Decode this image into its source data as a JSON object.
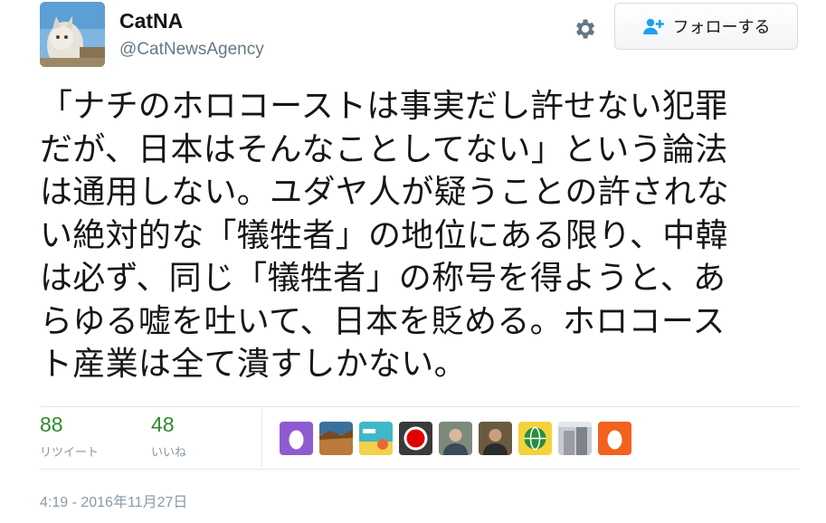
{
  "user": {
    "display_name": "CatNA",
    "screen_name": "@CatNewsAgency"
  },
  "follow_button": {
    "label": "フォローする",
    "icon": "person-add-icon"
  },
  "settings_icon": "gear-icon",
  "tweet": {
    "lines": [
      "「ナチのホロコーストは事実だし許せない犯罪",
      "だが、日本はそんなことしてない」という論法",
      "は通用しない。ユダヤ人が疑うことの許されな",
      "い絶対的な「犠牲者」の地位にある限り、中韓",
      "は必ず、同じ「犠牲者」の称号を得ようと、あ",
      "らゆる嘘を吐いて、日本を貶める。ホロコース",
      "ト産業は全て潰すしかない。"
    ]
  },
  "stats": {
    "retweets": {
      "count": "88",
      "label": "リツイート"
    },
    "likes": {
      "count": "48",
      "label": "いいね"
    }
  },
  "likers": [
    {
      "kind": "egg",
      "color": "#8e5bd1"
    },
    {
      "kind": "landscape",
      "color": "#b97a3c"
    },
    {
      "kind": "cartoon",
      "color": "#3fb8c8"
    },
    {
      "kind": "flag",
      "color": "#e00000"
    },
    {
      "kind": "photo",
      "color": "#7d8a7a"
    },
    {
      "kind": "photo",
      "color": "#6a5a3f"
    },
    {
      "kind": "globe",
      "color": "#2a8c3c"
    },
    {
      "kind": "building",
      "color": "#9a9ea4"
    },
    {
      "kind": "egg",
      "color": "#f2611d"
    }
  ],
  "timestamp": "4:19 - 2016年11月27日",
  "colors": {
    "stat_number": "#2f8a2f",
    "muted": "#8899a6",
    "divider": "#e1e8ed"
  }
}
